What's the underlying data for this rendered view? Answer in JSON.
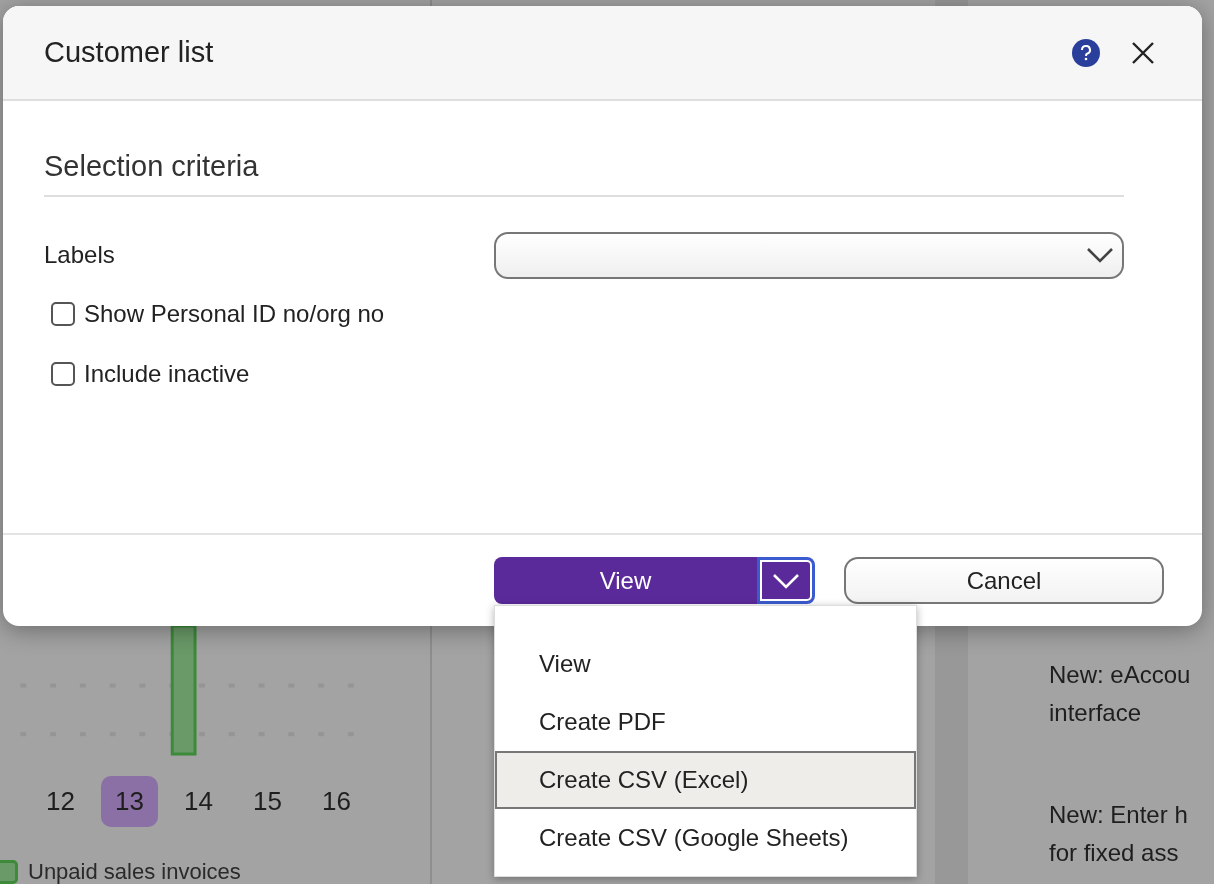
{
  "background": {
    "chart": {
      "days": [
        {
          "label": "12",
          "selected": false
        },
        {
          "label": "13",
          "selected": true
        },
        {
          "label": "14",
          "selected": false
        },
        {
          "label": "15",
          "selected": false
        },
        {
          "label": "16",
          "selected": false
        }
      ],
      "legend": "Unpaid sales invoices"
    },
    "news": [
      {
        "lines": [
          "New: eAccou",
          "interface"
        ]
      },
      {
        "lines": [
          "New: Enter h",
          "for fixed ass"
        ]
      }
    ]
  },
  "dialog": {
    "title": "Customer list",
    "section_title": "Selection criteria",
    "fields": [
      {
        "label": "Labels",
        "kind": "select"
      }
    ],
    "checkboxes": [
      {
        "label": "Show Personal ID no/org no",
        "checked": false
      },
      {
        "label": "Include inactive",
        "checked": false
      }
    ],
    "primary_button": {
      "label": "View",
      "menu_open": true
    },
    "cancel_button": {
      "label": "Cancel"
    }
  },
  "dropdown_menu": {
    "items": [
      {
        "label": "View",
        "selected": false
      },
      {
        "label": "Create PDF",
        "selected": false
      },
      {
        "label": "Create CSV (Excel)",
        "selected": true
      },
      {
        "label": "Create CSV (Google Sheets)",
        "selected": false
      }
    ]
  }
}
